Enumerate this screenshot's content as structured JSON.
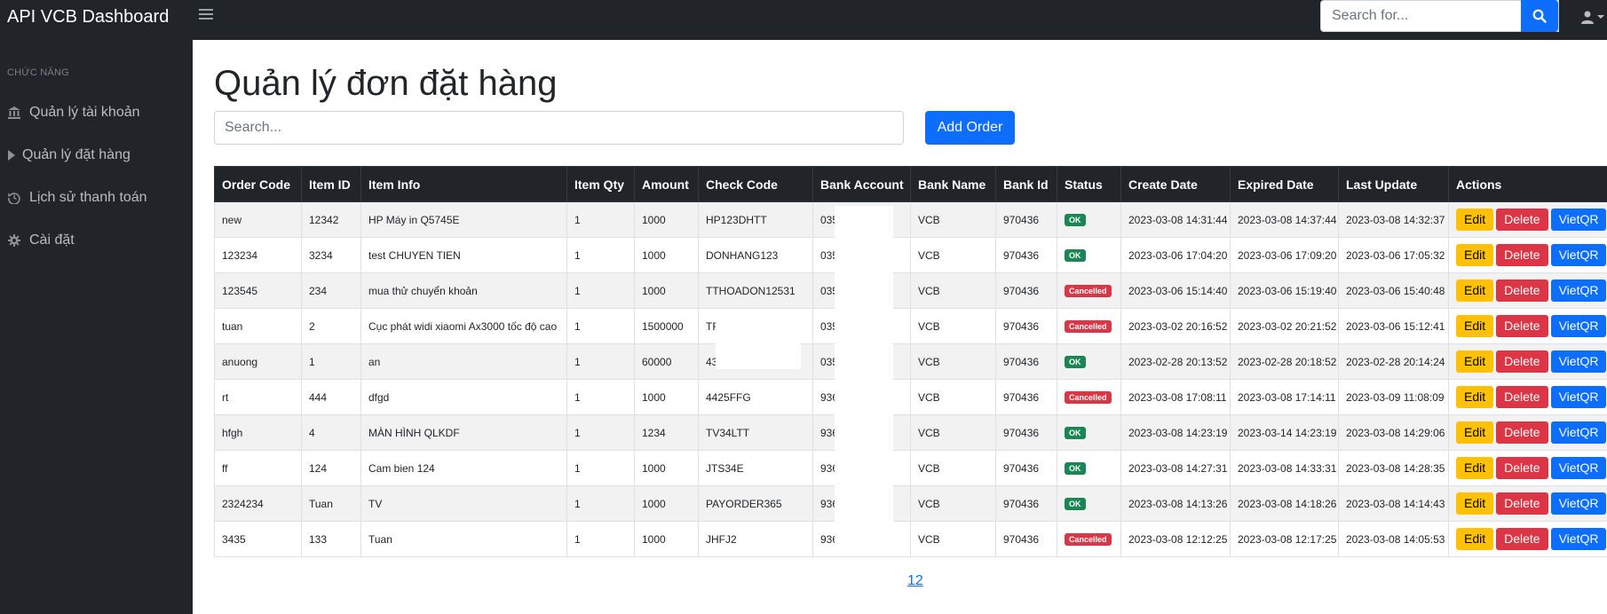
{
  "app": {
    "title": "API VCB Dashboard"
  },
  "topbar": {
    "search_placeholder": "Search for..."
  },
  "sidebar": {
    "heading": "CHỨC NĂNG",
    "items": [
      {
        "label": "Quản lý tài khoản",
        "icon": "bank-icon"
      },
      {
        "label": "Quản lý đặt hàng",
        "icon": "caret-right-icon"
      },
      {
        "label": "Lịch sử thanh toán",
        "icon": "history-icon"
      },
      {
        "label": "Cài đặt",
        "icon": "gear-icon"
      }
    ]
  },
  "main": {
    "title": "Quản lý đơn đặt hàng",
    "search_placeholder": "Search...",
    "add_label": "Add Order"
  },
  "table": {
    "columns": [
      "Order Code",
      "Item ID",
      "Item Info",
      "Item Qty",
      "Amount",
      "Check Code",
      "Bank Account",
      "Bank Name",
      "Bank Id",
      "Status",
      "Create Date",
      "Expired Date",
      "Last Update",
      "Actions"
    ],
    "rows": [
      {
        "order_code": "new",
        "item_id": "12342",
        "item_info": "HP Máy in Q5745E",
        "item_qty": "1",
        "amount": "1000",
        "check_code": "HP123DHTT",
        "bank_account": "035",
        "bank_name": "VCB",
        "bank_id": "970436",
        "status": "OK",
        "create_date": "2023-03-08 14:31:44",
        "expired_date": "2023-03-08 14:37:44",
        "last_update": "2023-03-08 14:32:37"
      },
      {
        "order_code": "123234",
        "item_id": "3234",
        "item_info": "test CHUYEN TIEN",
        "item_qty": "1",
        "amount": "1000",
        "check_code": "DONHANG123",
        "bank_account": "035",
        "bank_name": "VCB",
        "bank_id": "970436",
        "status": "OK",
        "create_date": "2023-03-06 17:04:20",
        "expired_date": "2023-03-06 17:09:20",
        "last_update": "2023-03-06 17:05:32"
      },
      {
        "order_code": "123545",
        "item_id": "234",
        "item_info": "mua thử chuyển khoản",
        "item_qty": "1",
        "amount": "1000",
        "check_code": "TTHOADON12531",
        "bank_account": "035",
        "bank_name": "VCB",
        "bank_id": "970436",
        "status": "Cancelled",
        "create_date": "2023-03-06 15:14:40",
        "expired_date": "2023-03-06 15:19:40",
        "last_update": "2023-03-06 15:40:48"
      },
      {
        "order_code": "tuan",
        "item_id": "2",
        "item_info": "Cục phát widi xiaomi Ax3000 tốc độ cao",
        "item_qty": "1",
        "amount": "1500000",
        "check_code": "TF",
        "bank_account": "035",
        "bank_name": "VCB",
        "bank_id": "970436",
        "status": "Cancelled",
        "create_date": "2023-03-02 20:16:52",
        "expired_date": "2023-03-02 20:21:52",
        "last_update": "2023-03-06 15:12:41"
      },
      {
        "order_code": "anuong",
        "item_id": "1",
        "item_info": "an",
        "item_qty": "1",
        "amount": "60000",
        "check_code": "43",
        "bank_account": "035",
        "bank_name": "VCB",
        "bank_id": "970436",
        "status": "OK",
        "create_date": "2023-02-28 20:13:52",
        "expired_date": "2023-02-28 20:18:52",
        "last_update": "2023-02-28 20:14:24"
      },
      {
        "order_code": "rt",
        "item_id": "444",
        "item_info": "dfgd",
        "item_qty": "1",
        "amount": "1000",
        "check_code": "4425FFG",
        "bank_account": "936",
        "bank_name": "VCB",
        "bank_id": "970436",
        "status": "Cancelled",
        "create_date": "2023-03-08 17:08:11",
        "expired_date": "2023-03-08 17:14:11",
        "last_update": "2023-03-09 11:08:09"
      },
      {
        "order_code": "hfgh",
        "item_id": "4",
        "item_info": "MÀN HÌNH QLKDF",
        "item_qty": "1",
        "amount": "1234",
        "check_code": "TV34LTT",
        "bank_account": "936",
        "bank_name": "VCB",
        "bank_id": "970436",
        "status": "OK",
        "create_date": "2023-03-08 14:23:19",
        "expired_date": "2023-03-14 14:23:19",
        "last_update": "2023-03-08 14:29:06"
      },
      {
        "order_code": "ff",
        "item_id": "124",
        "item_info": "Cam bien 124",
        "item_qty": "1",
        "amount": "1000",
        "check_code": "JTS34E",
        "bank_account": "936",
        "bank_name": "VCB",
        "bank_id": "970436",
        "status": "OK",
        "create_date": "2023-03-08 14:27:31",
        "expired_date": "2023-03-08 14:33:31",
        "last_update": "2023-03-08 14:28:35"
      },
      {
        "order_code": "2324234",
        "item_id": "Tuan",
        "item_info": "TV",
        "item_qty": "1",
        "amount": "1000",
        "check_code": "PAYORDER365",
        "bank_account": "936",
        "bank_name": "VCB",
        "bank_id": "970436",
        "status": "OK",
        "create_date": "2023-03-08 14:13:26",
        "expired_date": "2023-03-08 14:18:26",
        "last_update": "2023-03-08 14:14:43"
      },
      {
        "order_code": "3435",
        "item_id": "133",
        "item_info": "Tuan",
        "item_qty": "1",
        "amount": "1000",
        "check_code": "JHFJ2",
        "bank_account": "936",
        "bank_name": "VCB",
        "bank_id": "970436",
        "status": "Cancelled",
        "create_date": "2023-03-08 12:12:25",
        "expired_date": "2023-03-08 12:17:25",
        "last_update": "2023-03-08 14:05:53"
      }
    ],
    "actions": {
      "edit": "Edit",
      "delete": "Delete",
      "vietqr": "VietQR"
    }
  },
  "pagination": {
    "label": "12"
  },
  "colors": {
    "sidebar_bg": "#212529",
    "accent": "#0d6efd",
    "ok": "#198754",
    "cancelled": "#dc3545",
    "edit": "#ffc107"
  }
}
